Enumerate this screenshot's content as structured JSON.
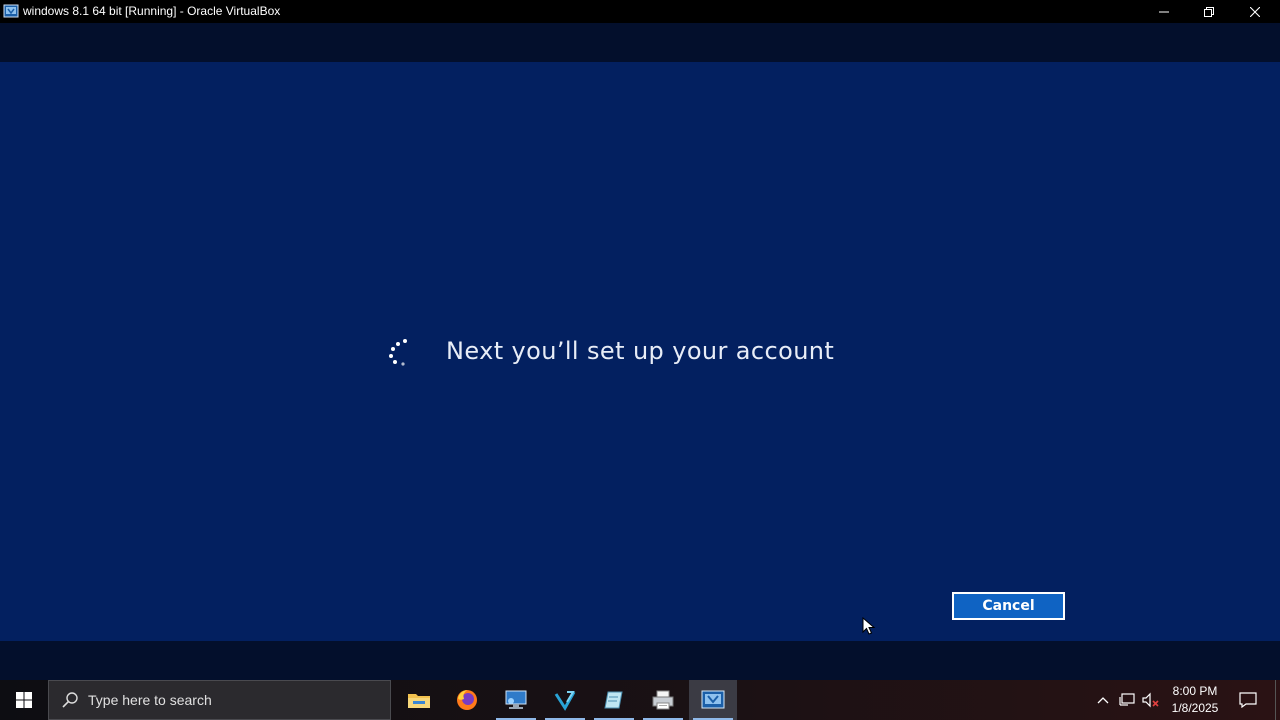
{
  "window": {
    "title": "windows 8.1 64 bit [Running] - Oracle VirtualBox",
    "icon": "virtualbox-icon",
    "controls": [
      "minimize-icon",
      "restore-icon",
      "close-icon"
    ]
  },
  "guest": {
    "message": "Next you’ll set up your account",
    "cancel_label": "Cancel",
    "background_color": "#032060",
    "button_color": "#0f63c3"
  },
  "taskbar": {
    "search_placeholder": "Type here to search",
    "apps": [
      {
        "icon": "file-explorer-icon",
        "running": false
      },
      {
        "icon": "firefox-icon",
        "running": false
      },
      {
        "icon": "remote-desktop-icon",
        "running": true
      },
      {
        "icon": "visual-studio-code-icon",
        "running": true
      },
      {
        "icon": "notes-app-icon",
        "running": true
      },
      {
        "icon": "printer-app-icon",
        "running": true
      },
      {
        "icon": "virtualbox-icon",
        "running": true,
        "active": true
      }
    ],
    "tray_icons": [
      "chevron-up-icon",
      "network-icon",
      "volume-muted-icon"
    ],
    "clock": {
      "time": "8:00 PM",
      "date": "1/8/2025"
    }
  }
}
